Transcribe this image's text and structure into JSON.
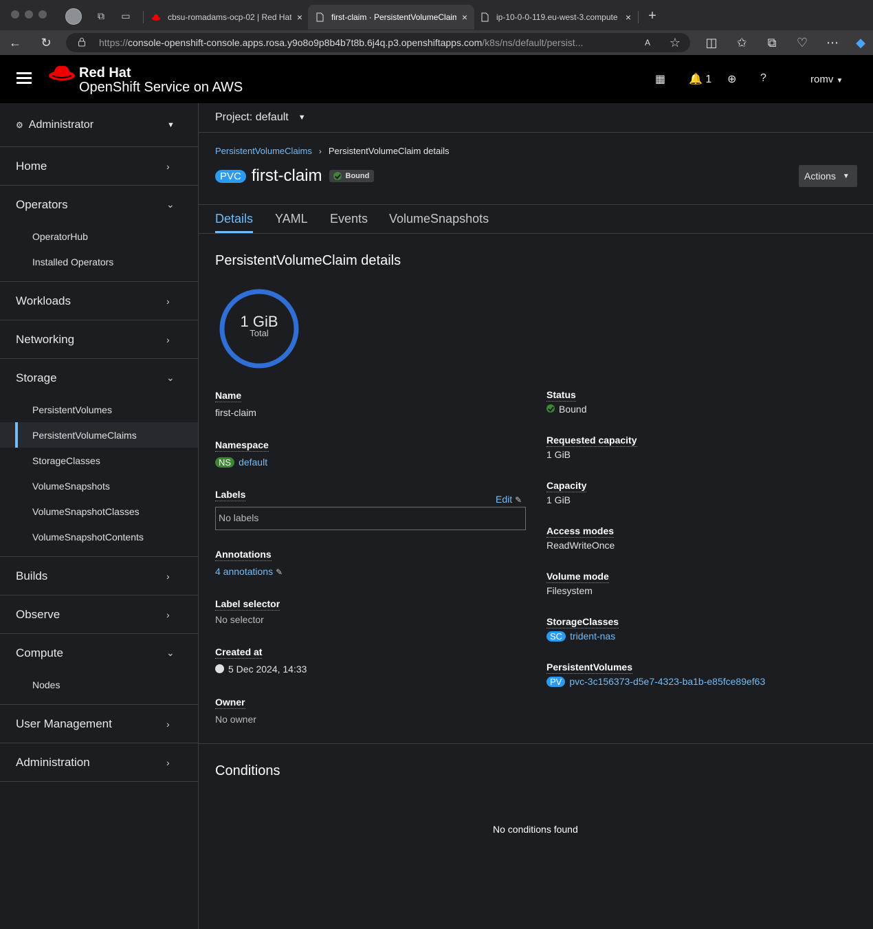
{
  "browser": {
    "tabs": [
      {
        "label": "cbsu-romadams-ocp-02 | Red Hat",
        "active": false
      },
      {
        "label": "first-claim · PersistentVolumeClaim",
        "active": true
      },
      {
        "label": "ip-10-0-0-119.eu-west-3.compute",
        "active": false
      }
    ],
    "url_prefix": "https://",
    "url_host": "console-openshift-console.apps.rosa.y9o8o9p8b4b7t8b.6j4q.p3.openshiftapps.com",
    "url_path": "/k8s/ns/default/persist..."
  },
  "masthead": {
    "brand_line1": "Red Hat",
    "brand_line2": "OpenShift Service on AWS",
    "notification_count": "1",
    "username": "romv"
  },
  "sidebar": {
    "perspective": "Administrator",
    "sections": [
      {
        "label": "Home",
        "expanded": false,
        "items": []
      },
      {
        "label": "Operators",
        "expanded": true,
        "items": [
          "OperatorHub",
          "Installed Operators"
        ]
      },
      {
        "label": "Workloads",
        "expanded": false,
        "items": []
      },
      {
        "label": "Networking",
        "expanded": false,
        "items": []
      },
      {
        "label": "Storage",
        "expanded": true,
        "items": [
          "PersistentVolumes",
          "PersistentVolumeClaims",
          "StorageClasses",
          "VolumeSnapshots",
          "VolumeSnapshotClasses",
          "VolumeSnapshotContents"
        ]
      },
      {
        "label": "Builds",
        "expanded": false,
        "items": []
      },
      {
        "label": "Observe",
        "expanded": false,
        "items": []
      },
      {
        "label": "Compute",
        "expanded": true,
        "items": [
          "Nodes"
        ]
      },
      {
        "label": "User Management",
        "expanded": false,
        "items": []
      },
      {
        "label": "Administration",
        "expanded": false,
        "items": []
      }
    ],
    "active_item": "PersistentVolumeClaims"
  },
  "main": {
    "project_label": "Project: default",
    "breadcrumb": {
      "parent": "PersistentVolumeClaims",
      "current": "PersistentVolumeClaim details"
    },
    "kind_badge": "PVC",
    "title": "first-claim",
    "status_pill": "Bound",
    "actions_label": "Actions",
    "tabs": [
      "Details",
      "YAML",
      "Events",
      "VolumeSnapshots"
    ],
    "active_tab": "Details",
    "details_heading": "PersistentVolumeClaim details",
    "donut": {
      "value": "1 GiB",
      "caption": "Total"
    },
    "left": {
      "name_label": "Name",
      "name_value": "first-claim",
      "namespace_label": "Namespace",
      "namespace_badge": "NS",
      "namespace_value": "default",
      "labels_label": "Labels",
      "labels_edit": "Edit",
      "labels_value": "No labels",
      "annotations_label": "Annotations",
      "annotations_value": "4 annotations",
      "label_selector_label": "Label selector",
      "label_selector_value": "No selector",
      "created_label": "Created at",
      "created_value": "5 Dec 2024, 14:33",
      "owner_label": "Owner",
      "owner_value": "No owner"
    },
    "right": {
      "status_label": "Status",
      "status_value": "Bound",
      "requested_label": "Requested capacity",
      "requested_value": "1 GiB",
      "capacity_label": "Capacity",
      "capacity_value": "1 GiB",
      "access_label": "Access modes",
      "access_value": "ReadWriteOnce",
      "volume_mode_label": "Volume mode",
      "volume_mode_value": "Filesystem",
      "storageclass_label": "StorageClasses",
      "storageclass_badge": "SC",
      "storageclass_value": "trident-nas",
      "pv_label": "PersistentVolumes",
      "pv_badge": "PV",
      "pv_value": "pvc-3c156373-d5e7-4323-ba1b-e85fce89ef63"
    },
    "conditions_heading": "Conditions",
    "conditions_empty": "No conditions found"
  }
}
